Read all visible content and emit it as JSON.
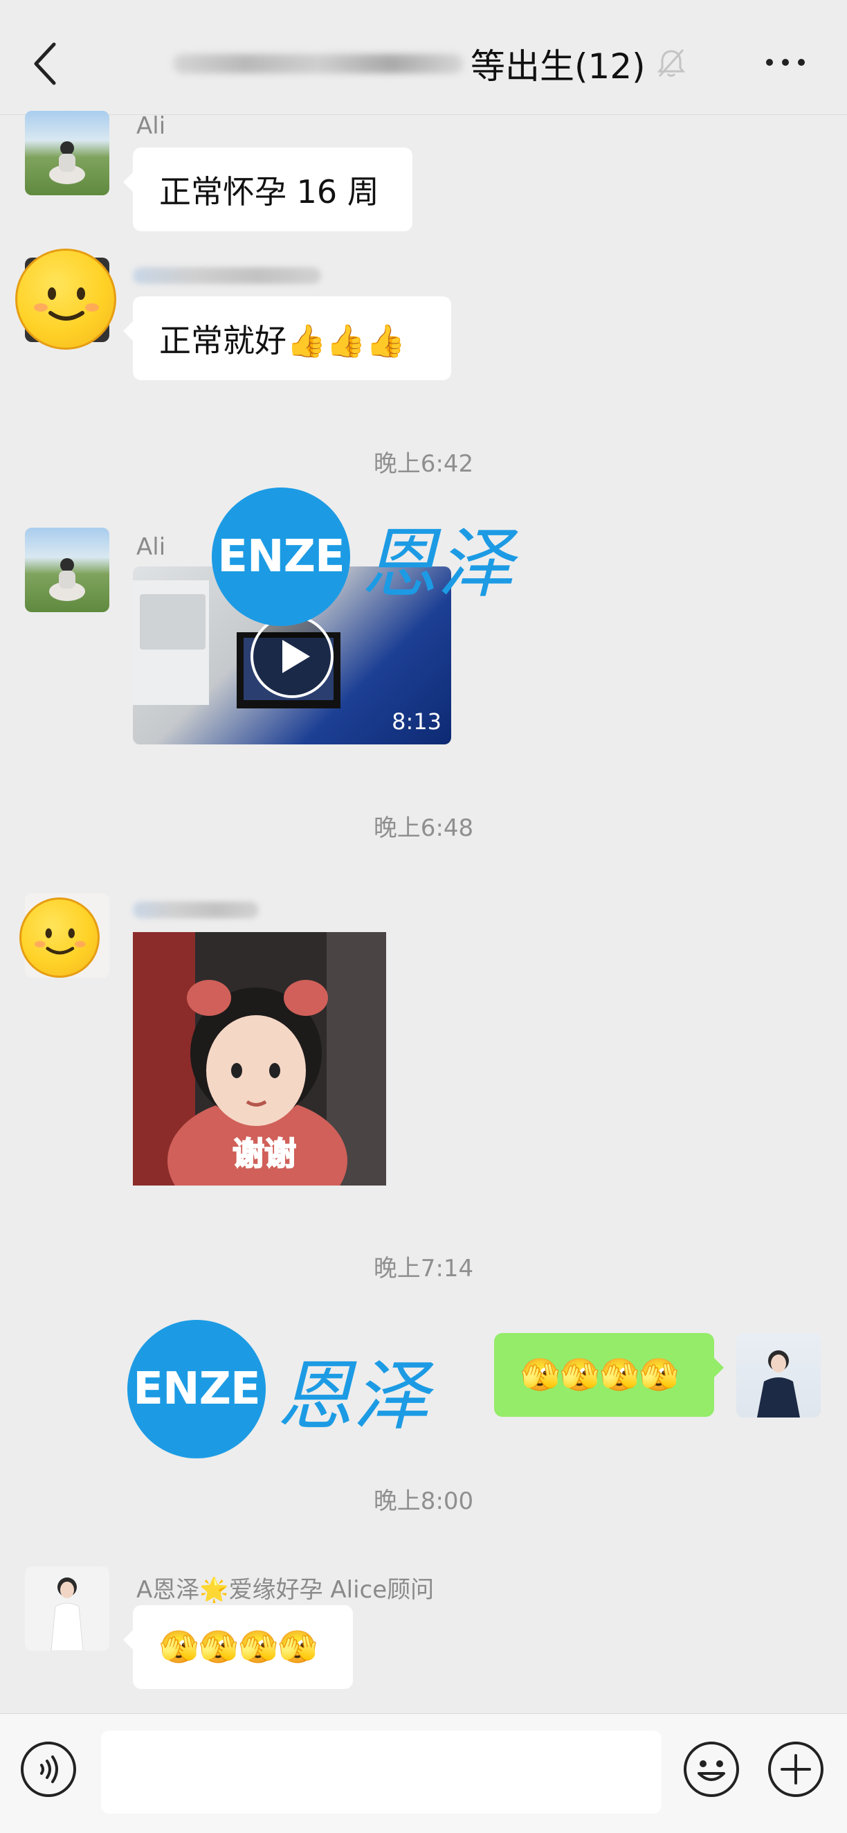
{
  "header": {
    "title": "等出生(12)"
  },
  "messages": [
    {
      "sender": "Ali",
      "text": "正常怀孕 16 周"
    },
    {
      "text": "正常就好👍👍👍"
    },
    {
      "time": "晚上6:42"
    },
    {
      "sender": "Ali",
      "video_duration": "8:13"
    },
    {
      "time": "晚上6:48"
    },
    {
      "sticker_caption": "谢谢"
    },
    {
      "time": "晚上7:14"
    },
    {
      "text": "🫣🫣🫣🫣"
    },
    {
      "time": "晚上8:00"
    },
    {
      "sender": "A恩泽🌟爱缘好孕 Alice顾问",
      "text": "🫣🫣🫣🫣"
    }
  ],
  "watermark": {
    "latin": "ENZE",
    "cn": "恩泽"
  }
}
